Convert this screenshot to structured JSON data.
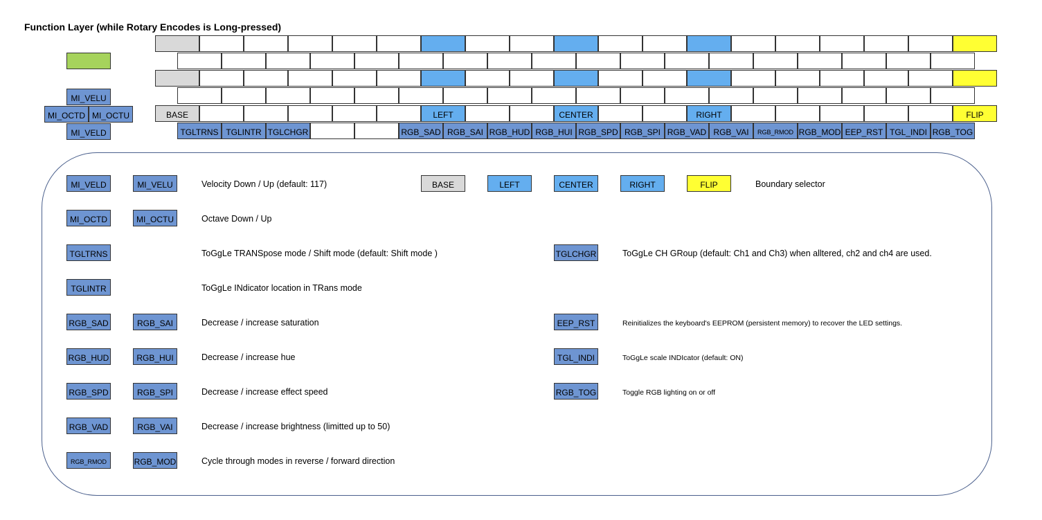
{
  "title": "Function Layer (while Rotary Encodes is Long-pressed)",
  "colors": {
    "base_gray": "#d9d9d9",
    "boundary_blue": "#64aeef",
    "flip_yellow": "#ffff33",
    "encoder_green": "#a6d35c",
    "function_blue": "#6e95d2"
  },
  "keyboard": {
    "boundary_row": {
      "base": "BASE",
      "left": "LEFT",
      "center": "CENTER",
      "right": "RIGHT",
      "flip": "FLIP"
    },
    "bottom_row": [
      "TGLTRNS",
      "TGLINTR",
      "TGLCHGR",
      "",
      "",
      "RGB_SAD",
      "RGB_SAI",
      "RGB_HUD",
      "RGB_HUI",
      "RGB_SPD",
      "RGB_SPI",
      "RGB_VAD",
      "RGB_VAI",
      "RGB_RMOD",
      "RGB_MOD",
      "EEP_RST",
      "TGL_INDI",
      "RGB_TOG"
    ],
    "encoder": {
      "velu": "MI_VELU",
      "octd": "MI_OCTD",
      "octu": "MI_OCTU",
      "veld": "MI_VELD"
    }
  },
  "legend": {
    "velocity": {
      "key1": "MI_VELD",
      "key2": "MI_VELU",
      "desc": "Velocity Down / Up (default: 117)"
    },
    "octave": {
      "key1": "MI_OCTD",
      "key2": "MI_OCTU",
      "desc": "Octave Down / Up"
    },
    "transpose": {
      "key1": "TGLTRNS",
      "desc": "ToGgLe TRANSpose mode / Shift mode (default: Shift mode )"
    },
    "indicator": {
      "key1": "TGLINTR",
      "desc": "ToGgLe INdicator location in TRans mode"
    },
    "saturation": {
      "key1": "RGB_SAD",
      "key2": "RGB_SAI",
      "desc": "Decrease / increase saturation"
    },
    "hue": {
      "key1": "RGB_HUD",
      "key2": "RGB_HUI",
      "desc": "Decrease / increase hue"
    },
    "speed": {
      "key1": "RGB_SPD",
      "key2": "RGB_SPI",
      "desc": "Decrease / increase effect speed"
    },
    "brightness": {
      "key1": "RGB_VAD",
      "key2": "RGB_VAI",
      "desc": "Decrease / increase brightness (limitted up to 50)"
    },
    "modes": {
      "key1": "RGB_RMOD",
      "key2": "RGB_MOD",
      "desc": "Cycle through modes in reverse / forward direction"
    },
    "boundary": {
      "base": "BASE",
      "left": "LEFT",
      "center": "CENTER",
      "right": "RIGHT",
      "flip": "FLIP",
      "desc": "Boundary selector"
    },
    "chgroup": {
      "key1": "TGLCHGR",
      "desc": "ToGgLe CH GRoup (default: Ch1 and Ch3) when alltered, ch2 and ch4 are used."
    },
    "eeprom": {
      "key1": "EEP_RST",
      "desc": "Reinitializes the keyboard's EEPROM (persistent memory) to recover the LED settings."
    },
    "scale_indicator": {
      "key1": "TGL_INDI",
      "desc": "ToGgLe scale INDIcator (default: ON)"
    },
    "rgb_toggle": {
      "key1": "RGB_TOG",
      "desc": "Toggle RGB lighting on or off"
    }
  }
}
